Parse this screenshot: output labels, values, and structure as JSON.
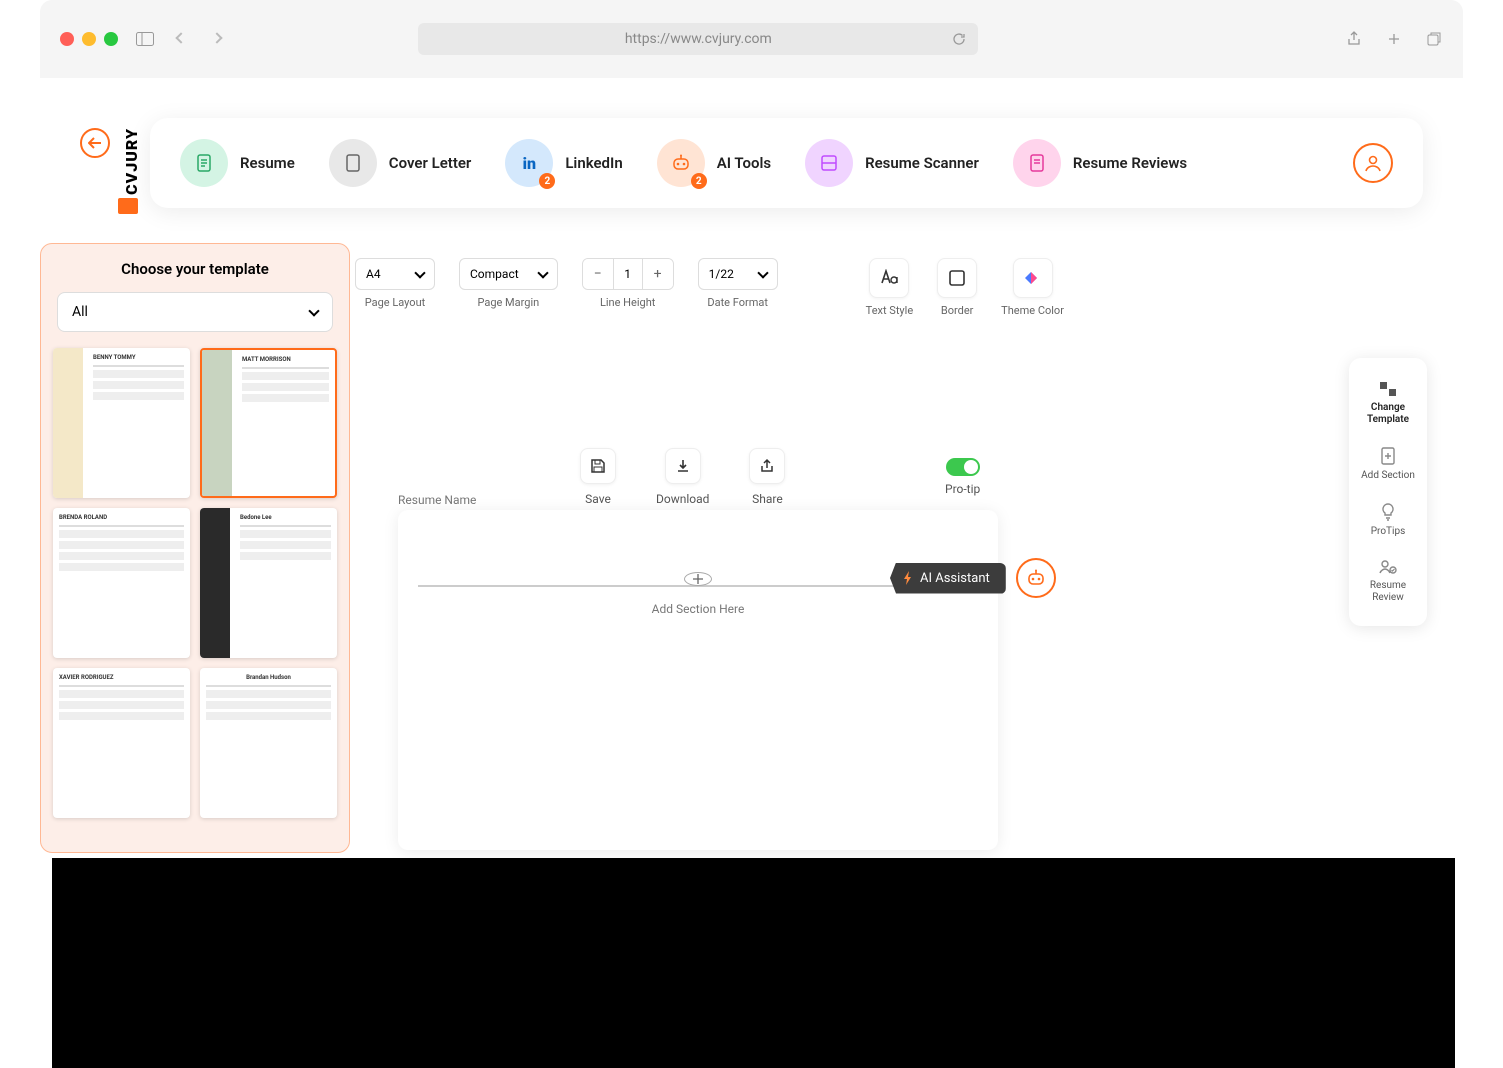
{
  "browser": {
    "url": "https://www.cvjury.com"
  },
  "brand": "CVJURY",
  "nav": {
    "resume": "Resume",
    "cover": "Cover Letter",
    "linkedin": "LinkedIn",
    "linkedin_badge": "2",
    "ai": "AI Tools",
    "ai_badge": "2",
    "scanner": "Resume Scanner",
    "reviews": "Resume Reviews"
  },
  "template_panel": {
    "title": "Choose your template",
    "filter": "All",
    "thumbs": [
      {
        "name": "BENNY TOMMY"
      },
      {
        "name": "MATT MORRISON"
      },
      {
        "name": "BRENDA ROLAND"
      },
      {
        "name": "Bedone Lee"
      },
      {
        "name": "XAVIER RODRIGUEZ"
      },
      {
        "name": "Brandan Hudson"
      }
    ]
  },
  "toolbar": {
    "page_layout": {
      "value": "A4",
      "label": "Page Layout"
    },
    "page_margin": {
      "value": "Compact",
      "label": "Page Margin"
    },
    "line_height": {
      "value": "1",
      "label": "Line Height"
    },
    "date_format": {
      "value": "1/22",
      "label": "Date Format"
    },
    "text_style": "Text Style",
    "border": "Border",
    "theme_color": "Theme Color"
  },
  "actions": {
    "save": "Save",
    "download": "Download",
    "share": "Share",
    "protip": "Pro-tip"
  },
  "canvas": {
    "resume_name": "Resume Name",
    "add_section": "Add Section Here"
  },
  "ai_assistant": "AI Assistant",
  "side": {
    "change_template": "Change Template",
    "add_section": "Add Section",
    "protips": "ProTips",
    "resume_review": "Resume Review"
  }
}
